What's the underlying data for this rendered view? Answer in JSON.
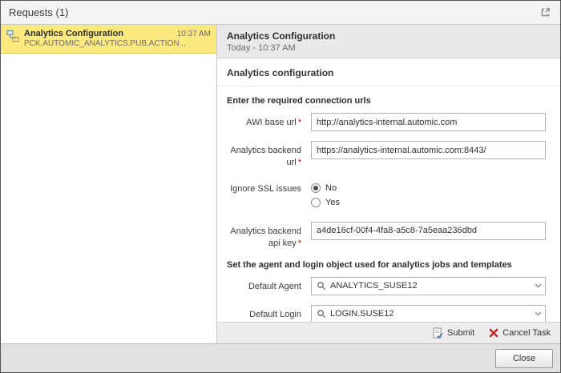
{
  "window": {
    "title": "Requests (1)"
  },
  "request_list": {
    "items": [
      {
        "title": "Analytics Configuration",
        "subtitle": "PCK.AUTOMIC_ANALYTICS.PUB.ACTION...",
        "time": "10:37 AM"
      }
    ]
  },
  "detail": {
    "title": "Analytics Configuration",
    "timestamp": "Today - 10:37 AM",
    "form_title": "Analytics configuration",
    "connection_section_title": "Enter the required connection urls",
    "awi_base_url": {
      "label": "AWI base url",
      "required_marker": "*",
      "value": "http://analytics-internal.automic.com"
    },
    "backend_url": {
      "label": "Analytics backend url",
      "required_marker": "*",
      "value": "https://analytics-internal.automic.com:8443/"
    },
    "ignore_ssl": {
      "label": "Ignore SSL issues",
      "options": [
        "No",
        "Yes"
      ],
      "selected": "No"
    },
    "api_key": {
      "label": "Analytics backend api key",
      "required_marker": "*",
      "value": "a4de16cf-00f4-4fa8-a5c8-7a5eaa236dbd"
    },
    "agent_section_title": "Set the agent and login object used for analytics jobs and templates",
    "default_agent": {
      "label": "Default Agent",
      "value": "ANALYTICS_SUSE12"
    },
    "default_login": {
      "label": "Default Login",
      "value": "LOGIN.SUSE12"
    }
  },
  "actions": {
    "submit": "Submit",
    "cancel_task": "Cancel Task",
    "close": "Close"
  },
  "icons": {
    "popout": "open-in-new-window-icon",
    "list_item": "workflow-icon",
    "combo_search": "search-icon",
    "combo_chevron": "chevron-down-icon"
  },
  "colors": {
    "selection_bg": "#fbe97e",
    "required_marker": "#d40000",
    "cancel_icon": "#c1272d",
    "header_bg": "#e9e9e9"
  }
}
